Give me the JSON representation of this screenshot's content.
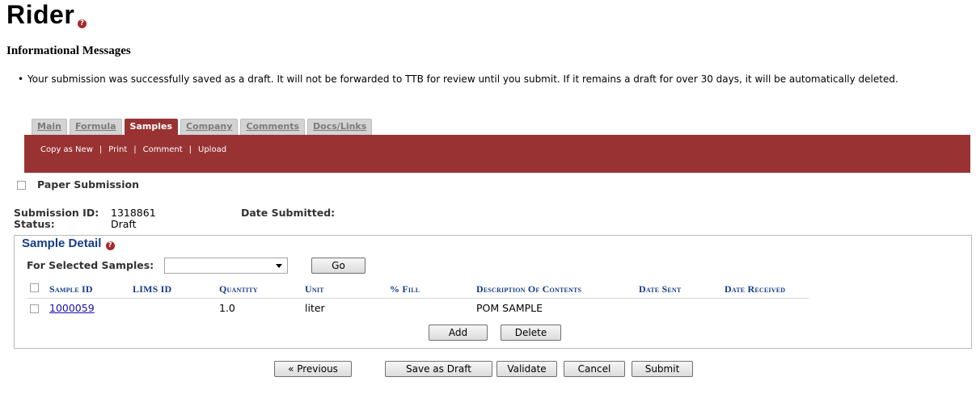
{
  "page": {
    "title": "Rider",
    "help_icon": "question-circle-icon"
  },
  "messages": {
    "heading": "Informational Messages",
    "items": [
      "Your submission was successfully saved as a draft. It will not be forwarded to TTB for review until you submit. If it remains a draft for over 30 days, it will be automatically deleted."
    ]
  },
  "tabs": [
    {
      "label": "Main",
      "active": false
    },
    {
      "label": "Formula",
      "active": false
    },
    {
      "label": "Samples",
      "active": true
    },
    {
      "label": "Company",
      "active": false
    },
    {
      "label": "Comments",
      "active": false
    },
    {
      "label": "Docs/Links",
      "active": false
    }
  ],
  "actions": [
    "Copy as New",
    "Print",
    "Comment",
    "Upload"
  ],
  "paper_submission": {
    "label": "Paper Submission",
    "checked": false
  },
  "submission": {
    "id_label": "Submission ID:",
    "id_value": "1318861",
    "date_label": "Date Submitted:",
    "date_value": "",
    "status_label": "Status:",
    "status_value": "Draft"
  },
  "sample_detail": {
    "legend": "Sample Detail",
    "for_selected_label": "For Selected Samples:",
    "select_value": "",
    "go_label": "Go",
    "columns": [
      "Sample ID",
      "LIMS ID",
      "Quantity",
      "Unit",
      "% Fill",
      "Description Of Contents",
      "Date Sent",
      "Date Received"
    ],
    "rows": [
      {
        "sample_id": "1000059",
        "lims_id": "",
        "quantity": "1.0",
        "unit": "liter",
        "fill": "",
        "description": "POM SAMPLE",
        "date_sent": "",
        "date_received": ""
      }
    ],
    "add_label": "Add",
    "delete_label": "Delete"
  },
  "footer_buttons": {
    "previous": "« Previous",
    "save_draft": "Save as Draft",
    "validate": "Validate",
    "cancel": "Cancel",
    "submit": "Submit"
  },
  "colors": {
    "accent": "#993333",
    "heading_blue": "#163c88",
    "link": "#1a0dab"
  }
}
